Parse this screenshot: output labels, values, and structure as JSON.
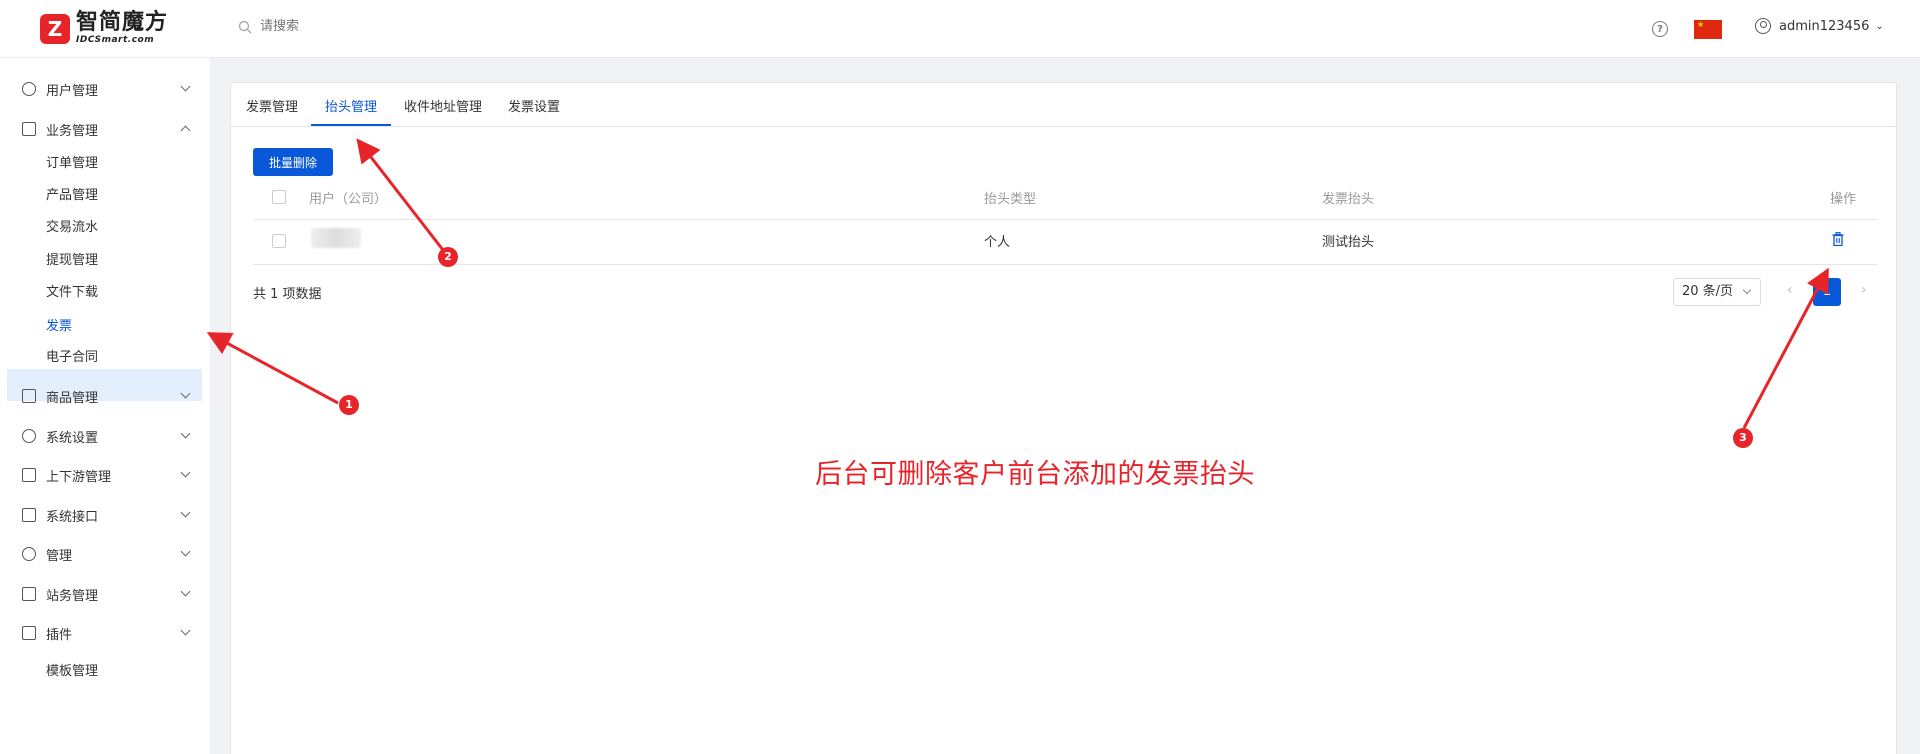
{
  "header": {
    "logo_mark": "Z",
    "logo_title": "智简魔方",
    "logo_subtitle": "IDCSmart.com",
    "search_placeholder": "请搜索",
    "help_symbol": "?",
    "language_flag": "china-flag",
    "username": "admin123456"
  },
  "sidebar": {
    "items": [
      {
        "label": "用户管理",
        "icon": "user-icon",
        "expanded": false
      },
      {
        "label": "业务管理",
        "icon": "document-icon",
        "expanded": true
      },
      {
        "label": "商品管理",
        "icon": "cart-icon",
        "expanded": false
      },
      {
        "label": "系统设置",
        "icon": "gear-icon",
        "expanded": false
      },
      {
        "label": "上下游管理",
        "icon": "filter-icon",
        "expanded": false
      },
      {
        "label": "系统接口",
        "icon": "folder-icon",
        "expanded": false
      },
      {
        "label": "管理",
        "icon": "sparkle-icon",
        "expanded": false
      },
      {
        "label": "站务管理",
        "icon": "folder-plus-icon",
        "expanded": false
      },
      {
        "label": "插件",
        "icon": "cube-icon",
        "expanded": false
      }
    ],
    "sub_items": [
      "订单管理",
      "产品管理",
      "交易流水",
      "提现管理",
      "文件下载",
      "发票",
      "电子合同"
    ],
    "active_sub": "发票",
    "extra_item": "模板管理"
  },
  "tabs": [
    "发票管理",
    "抬头管理",
    "收件地址管理",
    "发票设置"
  ],
  "active_tab": "抬头管理",
  "toolbar": {
    "batch_delete": "批量删除"
  },
  "table": {
    "columns": [
      "用户（公司）",
      "抬头类型",
      "发票抬头",
      "操作"
    ],
    "rows": [
      {
        "user": "",
        "type": "个人",
        "title": "测试抬头",
        "action": "trash-icon"
      }
    ]
  },
  "pagination": {
    "total_text": "共 1 项数据",
    "page_size": "20 条/页",
    "current_page": "1",
    "prev": "‹",
    "next": "›"
  },
  "annotation": {
    "text": "后台可删除客户前台添加的发票抬头",
    "markers": [
      "1",
      "2",
      "3"
    ],
    "color": "#e8242b"
  },
  "colors": {
    "primary": "#0958d9",
    "accent": "#e8242b",
    "background": "#f0f2f5"
  }
}
